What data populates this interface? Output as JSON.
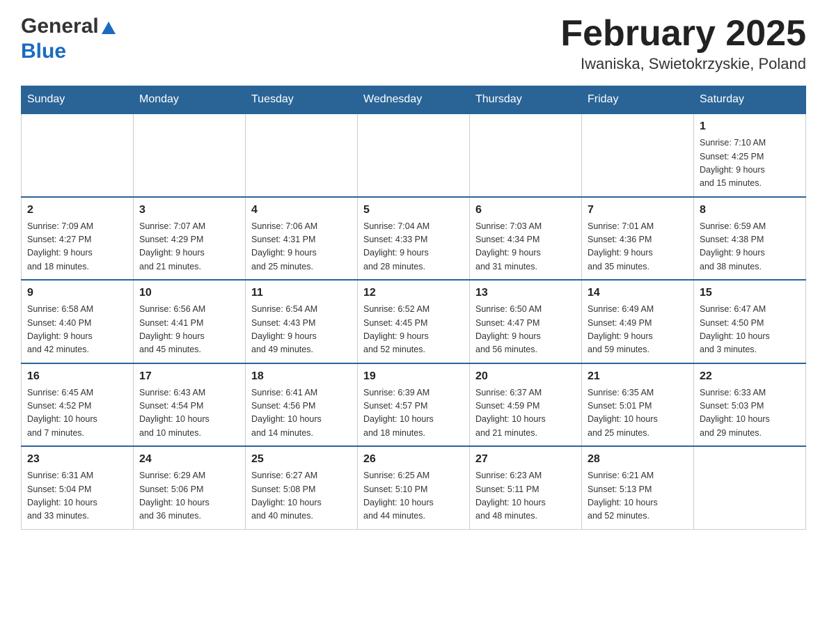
{
  "header": {
    "logo_general": "General",
    "logo_blue": "Blue",
    "title": "February 2025",
    "subtitle": "Iwaniska, Swietokrzyskie, Poland"
  },
  "calendar": {
    "days_of_week": [
      "Sunday",
      "Monday",
      "Tuesday",
      "Wednesday",
      "Thursday",
      "Friday",
      "Saturday"
    ],
    "weeks": [
      {
        "cells": [
          {
            "day": "",
            "info": ""
          },
          {
            "day": "",
            "info": ""
          },
          {
            "day": "",
            "info": ""
          },
          {
            "day": "",
            "info": ""
          },
          {
            "day": "",
            "info": ""
          },
          {
            "day": "",
            "info": ""
          },
          {
            "day": "1",
            "info": "Sunrise: 7:10 AM\nSunset: 4:25 PM\nDaylight: 9 hours\nand 15 minutes."
          }
        ]
      },
      {
        "cells": [
          {
            "day": "2",
            "info": "Sunrise: 7:09 AM\nSunset: 4:27 PM\nDaylight: 9 hours\nand 18 minutes."
          },
          {
            "day": "3",
            "info": "Sunrise: 7:07 AM\nSunset: 4:29 PM\nDaylight: 9 hours\nand 21 minutes."
          },
          {
            "day": "4",
            "info": "Sunrise: 7:06 AM\nSunset: 4:31 PM\nDaylight: 9 hours\nand 25 minutes."
          },
          {
            "day": "5",
            "info": "Sunrise: 7:04 AM\nSunset: 4:33 PM\nDaylight: 9 hours\nand 28 minutes."
          },
          {
            "day": "6",
            "info": "Sunrise: 7:03 AM\nSunset: 4:34 PM\nDaylight: 9 hours\nand 31 minutes."
          },
          {
            "day": "7",
            "info": "Sunrise: 7:01 AM\nSunset: 4:36 PM\nDaylight: 9 hours\nand 35 minutes."
          },
          {
            "day": "8",
            "info": "Sunrise: 6:59 AM\nSunset: 4:38 PM\nDaylight: 9 hours\nand 38 minutes."
          }
        ]
      },
      {
        "cells": [
          {
            "day": "9",
            "info": "Sunrise: 6:58 AM\nSunset: 4:40 PM\nDaylight: 9 hours\nand 42 minutes."
          },
          {
            "day": "10",
            "info": "Sunrise: 6:56 AM\nSunset: 4:41 PM\nDaylight: 9 hours\nand 45 minutes."
          },
          {
            "day": "11",
            "info": "Sunrise: 6:54 AM\nSunset: 4:43 PM\nDaylight: 9 hours\nand 49 minutes."
          },
          {
            "day": "12",
            "info": "Sunrise: 6:52 AM\nSunset: 4:45 PM\nDaylight: 9 hours\nand 52 minutes."
          },
          {
            "day": "13",
            "info": "Sunrise: 6:50 AM\nSunset: 4:47 PM\nDaylight: 9 hours\nand 56 minutes."
          },
          {
            "day": "14",
            "info": "Sunrise: 6:49 AM\nSunset: 4:49 PM\nDaylight: 9 hours\nand 59 minutes."
          },
          {
            "day": "15",
            "info": "Sunrise: 6:47 AM\nSunset: 4:50 PM\nDaylight: 10 hours\nand 3 minutes."
          }
        ]
      },
      {
        "cells": [
          {
            "day": "16",
            "info": "Sunrise: 6:45 AM\nSunset: 4:52 PM\nDaylight: 10 hours\nand 7 minutes."
          },
          {
            "day": "17",
            "info": "Sunrise: 6:43 AM\nSunset: 4:54 PM\nDaylight: 10 hours\nand 10 minutes."
          },
          {
            "day": "18",
            "info": "Sunrise: 6:41 AM\nSunset: 4:56 PM\nDaylight: 10 hours\nand 14 minutes."
          },
          {
            "day": "19",
            "info": "Sunrise: 6:39 AM\nSunset: 4:57 PM\nDaylight: 10 hours\nand 18 minutes."
          },
          {
            "day": "20",
            "info": "Sunrise: 6:37 AM\nSunset: 4:59 PM\nDaylight: 10 hours\nand 21 minutes."
          },
          {
            "day": "21",
            "info": "Sunrise: 6:35 AM\nSunset: 5:01 PM\nDaylight: 10 hours\nand 25 minutes."
          },
          {
            "day": "22",
            "info": "Sunrise: 6:33 AM\nSunset: 5:03 PM\nDaylight: 10 hours\nand 29 minutes."
          }
        ]
      },
      {
        "cells": [
          {
            "day": "23",
            "info": "Sunrise: 6:31 AM\nSunset: 5:04 PM\nDaylight: 10 hours\nand 33 minutes."
          },
          {
            "day": "24",
            "info": "Sunrise: 6:29 AM\nSunset: 5:06 PM\nDaylight: 10 hours\nand 36 minutes."
          },
          {
            "day": "25",
            "info": "Sunrise: 6:27 AM\nSunset: 5:08 PM\nDaylight: 10 hours\nand 40 minutes."
          },
          {
            "day": "26",
            "info": "Sunrise: 6:25 AM\nSunset: 5:10 PM\nDaylight: 10 hours\nand 44 minutes."
          },
          {
            "day": "27",
            "info": "Sunrise: 6:23 AM\nSunset: 5:11 PM\nDaylight: 10 hours\nand 48 minutes."
          },
          {
            "day": "28",
            "info": "Sunrise: 6:21 AM\nSunset: 5:13 PM\nDaylight: 10 hours\nand 52 minutes."
          },
          {
            "day": "",
            "info": ""
          }
        ]
      }
    ]
  }
}
